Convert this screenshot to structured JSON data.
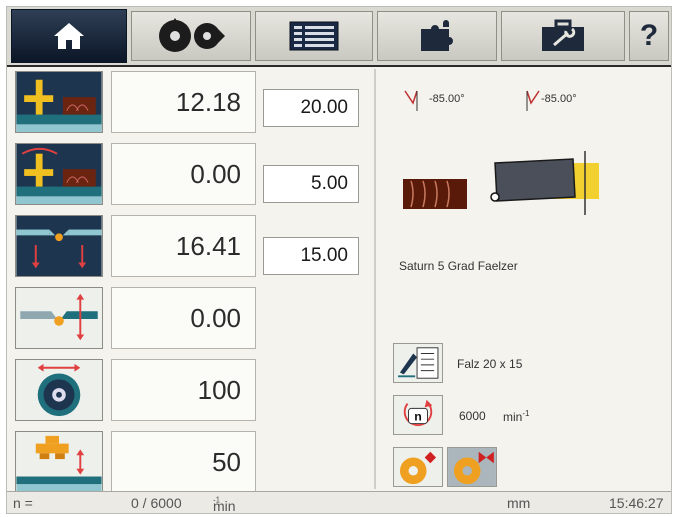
{
  "tabs": [
    {
      "name": "home-icon"
    },
    {
      "name": "saw-blades-icon"
    },
    {
      "name": "list-icon"
    },
    {
      "name": "puzzle-icon"
    },
    {
      "name": "toolbox-icon"
    },
    {
      "name": "help-icon",
      "label": "?"
    }
  ],
  "rows": [
    {
      "icon": "height-adjust-icon",
      "value": "12.18",
      "setpoint": "20.00"
    },
    {
      "icon": "angle-height-icon",
      "value": "0.00",
      "setpoint": "5.00"
    },
    {
      "icon": "blade-depth-icon",
      "value": "16.41",
      "setpoint": "15.00"
    },
    {
      "icon": "fence-angle-icon",
      "value": "0.00",
      "setpoint": ""
    },
    {
      "icon": "blade-diameter-icon",
      "value": "100",
      "setpoint": ""
    },
    {
      "icon": "pressure-roller-icon",
      "value": "50",
      "setpoint": ""
    }
  ],
  "right_panel": {
    "angle_left": "-85.00°",
    "angle_right": "-85.00°",
    "profile_name": "Saturn 5 Grad Faelzer",
    "program_label": "Falz 20 x 15",
    "speed_value": "6000",
    "speed_unit_base": "min",
    "speed_unit_exp": "-1"
  },
  "status": {
    "n_label": "n =",
    "rpm_value": "0 / 6000",
    "unit_base": "min",
    "unit_exp": "-1",
    "length_unit": "mm",
    "clock": "15:46:27"
  },
  "colors": {
    "active_tab": "#0b1627",
    "teal": "#1f6f7c",
    "brown": "#6b2410",
    "yellow": "#f0c020",
    "orange": "#f0a020"
  }
}
